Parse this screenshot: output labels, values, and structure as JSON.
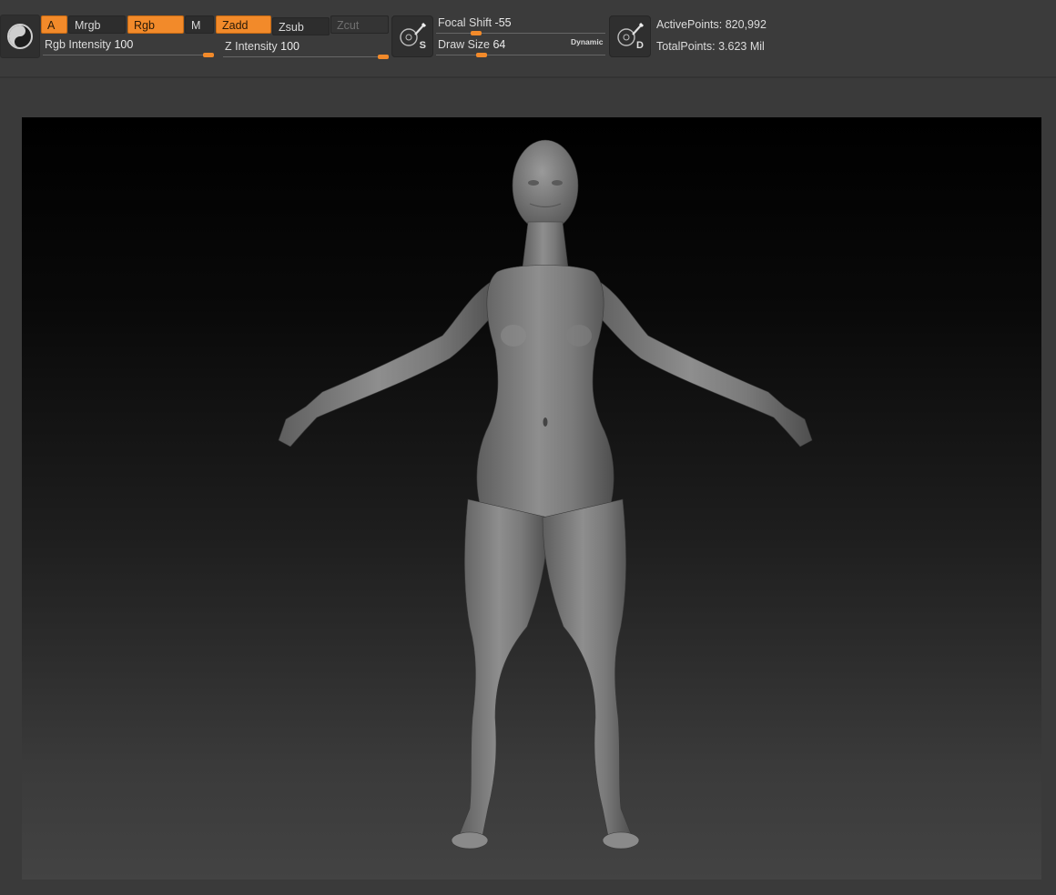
{
  "toolbar": {
    "a_label": "A",
    "mrgb_label": "Mrgb",
    "rgb_label": "Rgb",
    "m_label": "M",
    "zadd_label": "Zadd",
    "zsub_label": "Zsub",
    "zcut_label": "Zcut",
    "rgb_intensity": {
      "label": "Rgb Intensity",
      "value": "100",
      "level": 1.0
    },
    "z_intensity": {
      "label": "Z Intensity",
      "value": "100",
      "level": 1.0
    },
    "focal_shift": {
      "label": "Focal Shift",
      "value": "-55",
      "level": 0.22
    },
    "draw_size": {
      "label": "Draw Size",
      "value": "64",
      "level": 0.25
    },
    "dynamic_label": "Dynamic",
    "s_letter": "S",
    "d_letter": "D",
    "active_points": "ActivePoints: 820,992",
    "total_points": "TotalPoints: 3.623 Mil"
  },
  "colors": {
    "accent": "#f28a2a",
    "toolbar_bg": "#3b3b3b",
    "button_bg": "#2d2d2d"
  }
}
